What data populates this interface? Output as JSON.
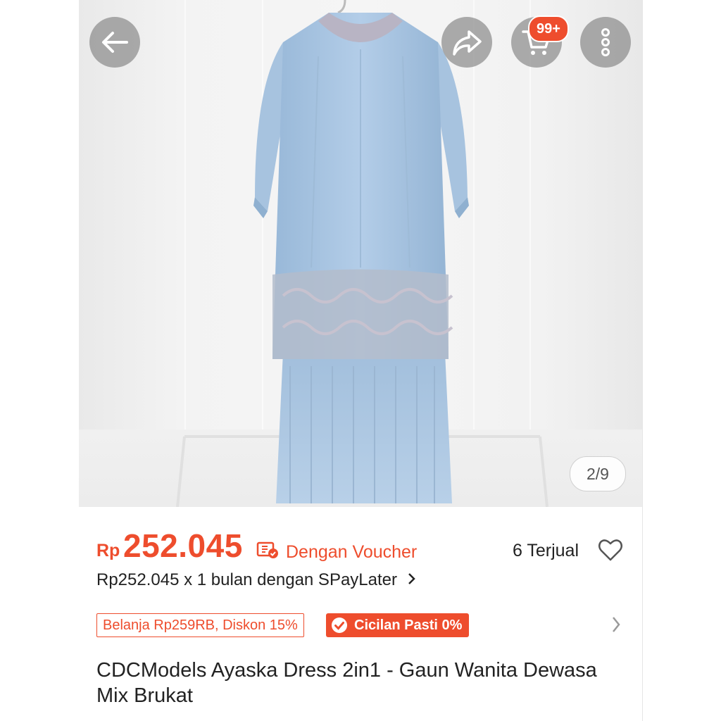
{
  "header": {
    "back_icon": "arrow-left-icon",
    "share_icon": "share-icon",
    "cart_icon": "cart-icon",
    "cart_badge": "99+",
    "more_icon": "more-vertical-icon"
  },
  "gallery": {
    "image_desc": "light blue long dress",
    "counter": "2/9"
  },
  "product": {
    "currency": "Rp",
    "price": "252.045",
    "voucher_label": "Dengan Voucher",
    "sold": "6 Terjual",
    "installment": "Rp252.045 x 1 bulan dengan SPayLater",
    "promo_discount": "Belanja Rp259RB, Diskon 15%",
    "promo_installment": "Cicilan Pasti 0%",
    "title": "CDCModels Ayaska Dress 2in1 - Gaun Wanita Dewasa Mix Brukat"
  },
  "colors": {
    "accent": "#ee4d2d",
    "dress": "#a9c6e3"
  }
}
